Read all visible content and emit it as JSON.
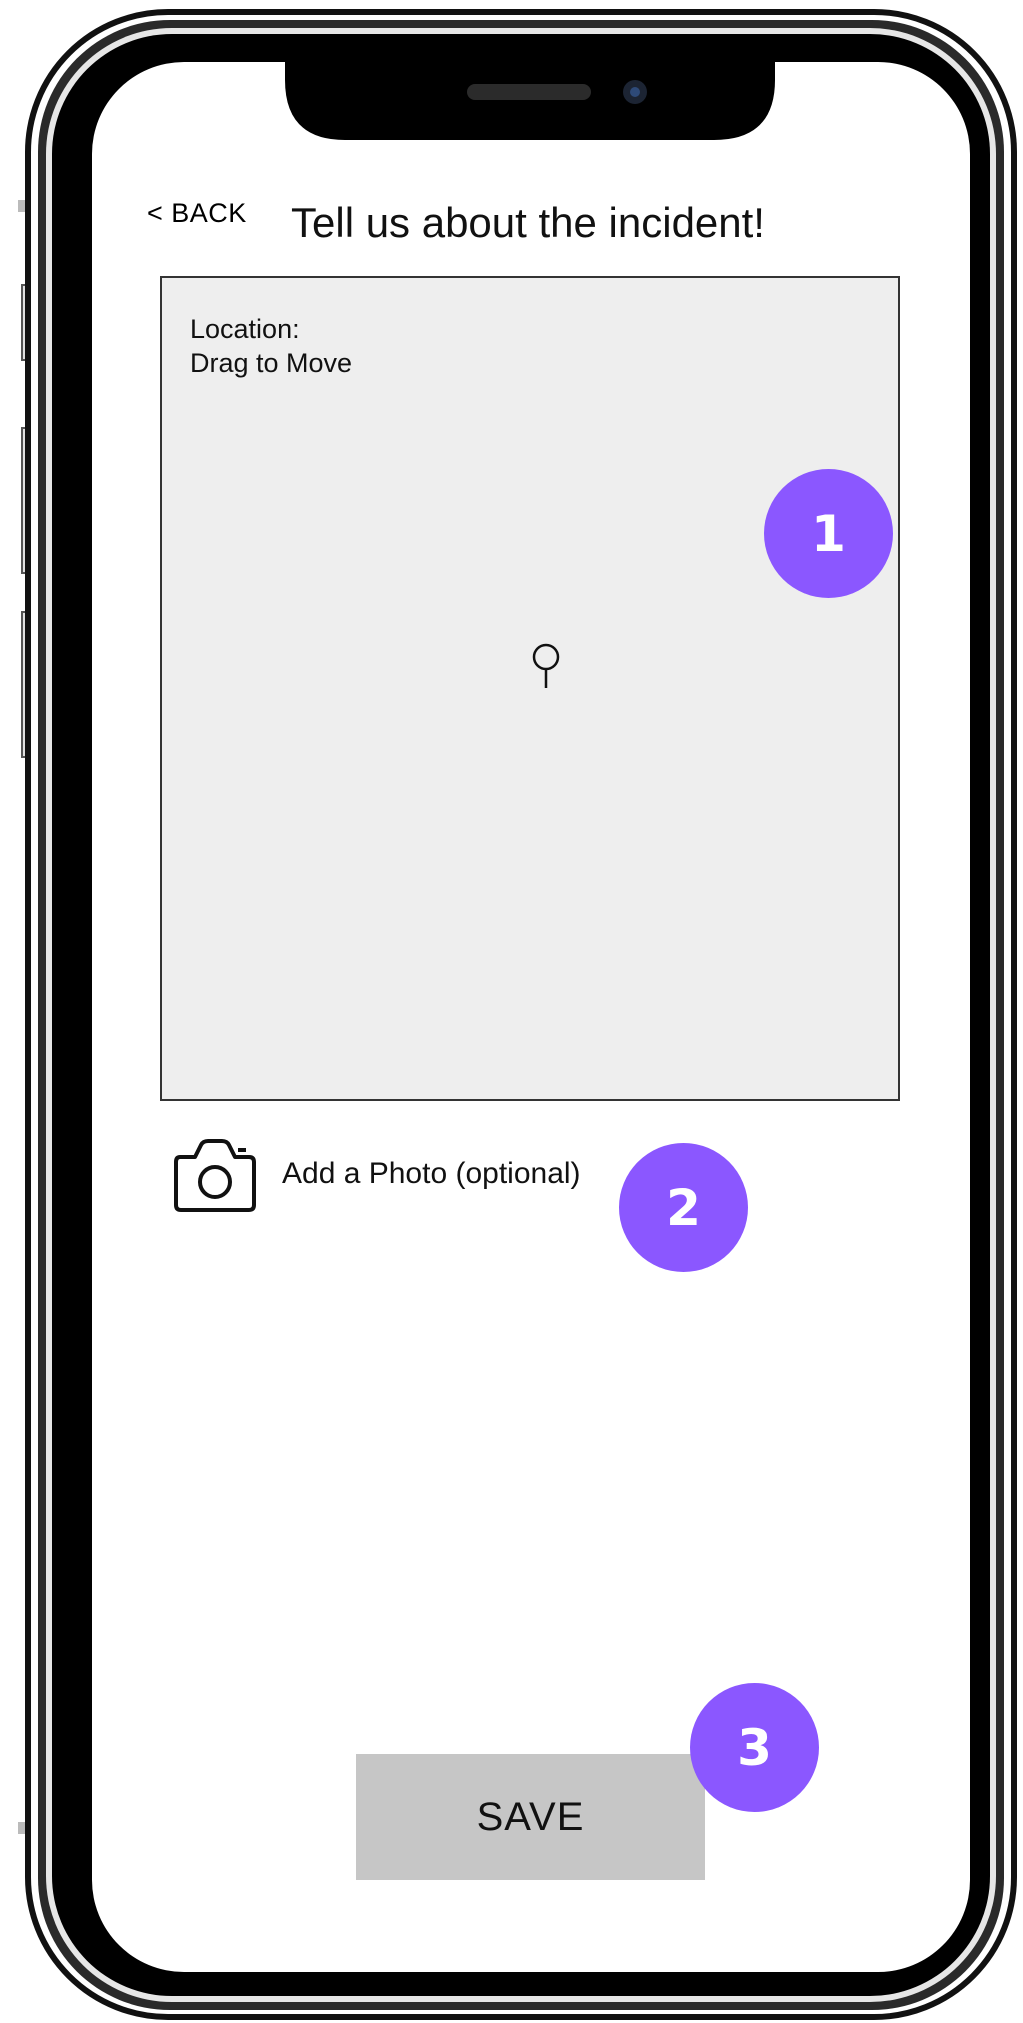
{
  "header": {
    "back_label": "< BACK",
    "title": "Tell us about the incident!"
  },
  "map": {
    "caption_line1": "Location:",
    "caption_line2": "Drag to Move",
    "pin_icon": "map-pin-icon"
  },
  "photo": {
    "icon": "camera-icon",
    "label": "Add a Photo (optional)"
  },
  "footer": {
    "save_label": "SAVE"
  },
  "annotations": [
    "1",
    "2",
    "3"
  ],
  "colors": {
    "badge": "#8b57ff",
    "map_background": "#eeeeee",
    "save_button": "#c6c6c6",
    "screen": "#ffffff",
    "frame": "#000000"
  }
}
